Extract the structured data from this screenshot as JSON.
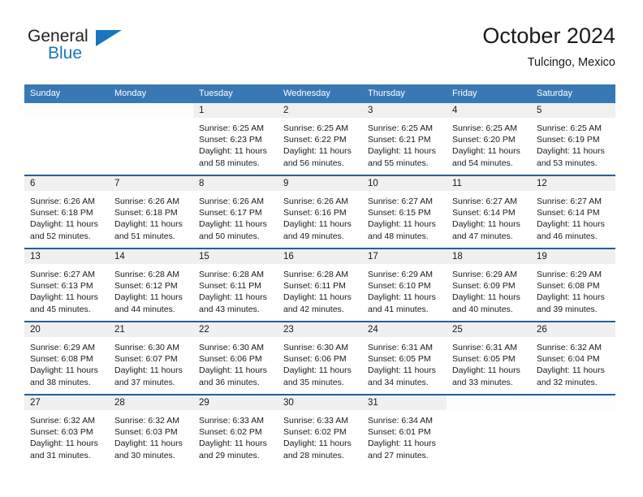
{
  "brand": {
    "line1": "General",
    "line2": "Blue",
    "flag_icon": "triangle-flag-icon",
    "color_primary": "#1a76bc",
    "color_text": "#231f20"
  },
  "header": {
    "month_title": "October 2024",
    "location": "Tulcingo, Mexico"
  },
  "theme": {
    "header_blue": "#3878b4",
    "separator_blue": "#21609e",
    "daynum_band": "#f0f0f0"
  },
  "calendar": {
    "weekday_headers": [
      "Sunday",
      "Monday",
      "Tuesday",
      "Wednesday",
      "Thursday",
      "Friday",
      "Saturday"
    ],
    "weeks": [
      [
        {
          "day": "",
          "sunrise": "",
          "sunset": "",
          "daylight": ""
        },
        {
          "day": "",
          "sunrise": "",
          "sunset": "",
          "daylight": ""
        },
        {
          "day": "1",
          "sunrise": "Sunrise: 6:25 AM",
          "sunset": "Sunset: 6:23 PM",
          "daylight": "Daylight: 11 hours and 58 minutes."
        },
        {
          "day": "2",
          "sunrise": "Sunrise: 6:25 AM",
          "sunset": "Sunset: 6:22 PM",
          "daylight": "Daylight: 11 hours and 56 minutes."
        },
        {
          "day": "3",
          "sunrise": "Sunrise: 6:25 AM",
          "sunset": "Sunset: 6:21 PM",
          "daylight": "Daylight: 11 hours and 55 minutes."
        },
        {
          "day": "4",
          "sunrise": "Sunrise: 6:25 AM",
          "sunset": "Sunset: 6:20 PM",
          "daylight": "Daylight: 11 hours and 54 minutes."
        },
        {
          "day": "5",
          "sunrise": "Sunrise: 6:25 AM",
          "sunset": "Sunset: 6:19 PM",
          "daylight": "Daylight: 11 hours and 53 minutes."
        }
      ],
      [
        {
          "day": "6",
          "sunrise": "Sunrise: 6:26 AM",
          "sunset": "Sunset: 6:18 PM",
          "daylight": "Daylight: 11 hours and 52 minutes."
        },
        {
          "day": "7",
          "sunrise": "Sunrise: 6:26 AM",
          "sunset": "Sunset: 6:18 PM",
          "daylight": "Daylight: 11 hours and 51 minutes."
        },
        {
          "day": "8",
          "sunrise": "Sunrise: 6:26 AM",
          "sunset": "Sunset: 6:17 PM",
          "daylight": "Daylight: 11 hours and 50 minutes."
        },
        {
          "day": "9",
          "sunrise": "Sunrise: 6:26 AM",
          "sunset": "Sunset: 6:16 PM",
          "daylight": "Daylight: 11 hours and 49 minutes."
        },
        {
          "day": "10",
          "sunrise": "Sunrise: 6:27 AM",
          "sunset": "Sunset: 6:15 PM",
          "daylight": "Daylight: 11 hours and 48 minutes."
        },
        {
          "day": "11",
          "sunrise": "Sunrise: 6:27 AM",
          "sunset": "Sunset: 6:14 PM",
          "daylight": "Daylight: 11 hours and 47 minutes."
        },
        {
          "day": "12",
          "sunrise": "Sunrise: 6:27 AM",
          "sunset": "Sunset: 6:14 PM",
          "daylight": "Daylight: 11 hours and 46 minutes."
        }
      ],
      [
        {
          "day": "13",
          "sunrise": "Sunrise: 6:27 AM",
          "sunset": "Sunset: 6:13 PM",
          "daylight": "Daylight: 11 hours and 45 minutes."
        },
        {
          "day": "14",
          "sunrise": "Sunrise: 6:28 AM",
          "sunset": "Sunset: 6:12 PM",
          "daylight": "Daylight: 11 hours and 44 minutes."
        },
        {
          "day": "15",
          "sunrise": "Sunrise: 6:28 AM",
          "sunset": "Sunset: 6:11 PM",
          "daylight": "Daylight: 11 hours and 43 minutes."
        },
        {
          "day": "16",
          "sunrise": "Sunrise: 6:28 AM",
          "sunset": "Sunset: 6:11 PM",
          "daylight": "Daylight: 11 hours and 42 minutes."
        },
        {
          "day": "17",
          "sunrise": "Sunrise: 6:29 AM",
          "sunset": "Sunset: 6:10 PM",
          "daylight": "Daylight: 11 hours and 41 minutes."
        },
        {
          "day": "18",
          "sunrise": "Sunrise: 6:29 AM",
          "sunset": "Sunset: 6:09 PM",
          "daylight": "Daylight: 11 hours and 40 minutes."
        },
        {
          "day": "19",
          "sunrise": "Sunrise: 6:29 AM",
          "sunset": "Sunset: 6:08 PM",
          "daylight": "Daylight: 11 hours and 39 minutes."
        }
      ],
      [
        {
          "day": "20",
          "sunrise": "Sunrise: 6:29 AM",
          "sunset": "Sunset: 6:08 PM",
          "daylight": "Daylight: 11 hours and 38 minutes."
        },
        {
          "day": "21",
          "sunrise": "Sunrise: 6:30 AM",
          "sunset": "Sunset: 6:07 PM",
          "daylight": "Daylight: 11 hours and 37 minutes."
        },
        {
          "day": "22",
          "sunrise": "Sunrise: 6:30 AM",
          "sunset": "Sunset: 6:06 PM",
          "daylight": "Daylight: 11 hours and 36 minutes."
        },
        {
          "day": "23",
          "sunrise": "Sunrise: 6:30 AM",
          "sunset": "Sunset: 6:06 PM",
          "daylight": "Daylight: 11 hours and 35 minutes."
        },
        {
          "day": "24",
          "sunrise": "Sunrise: 6:31 AM",
          "sunset": "Sunset: 6:05 PM",
          "daylight": "Daylight: 11 hours and 34 minutes."
        },
        {
          "day": "25",
          "sunrise": "Sunrise: 6:31 AM",
          "sunset": "Sunset: 6:05 PM",
          "daylight": "Daylight: 11 hours and 33 minutes."
        },
        {
          "day": "26",
          "sunrise": "Sunrise: 6:32 AM",
          "sunset": "Sunset: 6:04 PM",
          "daylight": "Daylight: 11 hours and 32 minutes."
        }
      ],
      [
        {
          "day": "27",
          "sunrise": "Sunrise: 6:32 AM",
          "sunset": "Sunset: 6:03 PM",
          "daylight": "Daylight: 11 hours and 31 minutes."
        },
        {
          "day": "28",
          "sunrise": "Sunrise: 6:32 AM",
          "sunset": "Sunset: 6:03 PM",
          "daylight": "Daylight: 11 hours and 30 minutes."
        },
        {
          "day": "29",
          "sunrise": "Sunrise: 6:33 AM",
          "sunset": "Sunset: 6:02 PM",
          "daylight": "Daylight: 11 hours and 29 minutes."
        },
        {
          "day": "30",
          "sunrise": "Sunrise: 6:33 AM",
          "sunset": "Sunset: 6:02 PM",
          "daylight": "Daylight: 11 hours and 28 minutes."
        },
        {
          "day": "31",
          "sunrise": "Sunrise: 6:34 AM",
          "sunset": "Sunset: 6:01 PM",
          "daylight": "Daylight: 11 hours and 27 minutes."
        },
        {
          "day": "",
          "sunrise": "",
          "sunset": "",
          "daylight": ""
        },
        {
          "day": "",
          "sunrise": "",
          "sunset": "",
          "daylight": ""
        }
      ]
    ]
  }
}
